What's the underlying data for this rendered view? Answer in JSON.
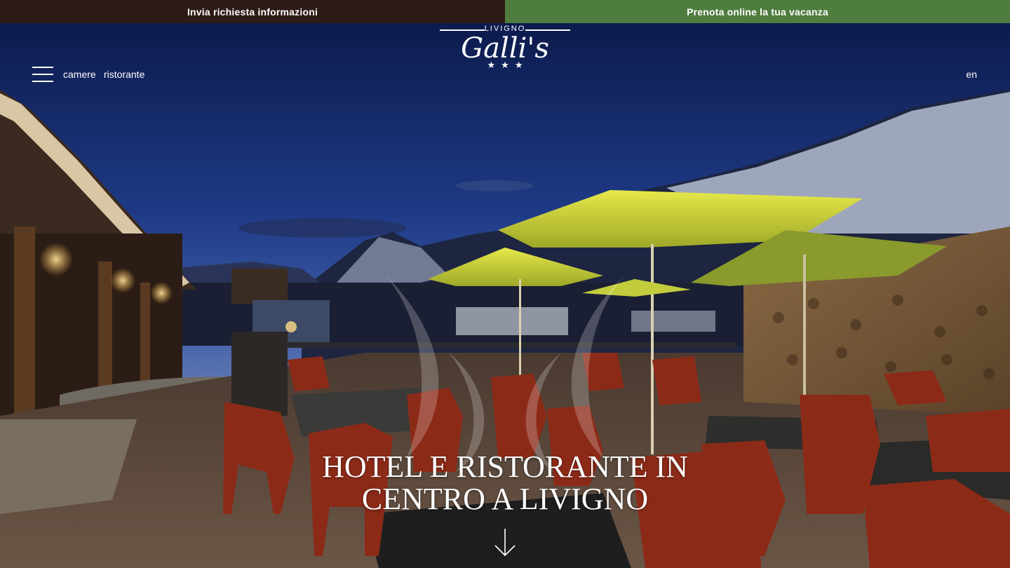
{
  "topbar": {
    "info_label": "Invia richiesta informazioni",
    "book_label": "Prenota online la tua vacanza"
  },
  "nav": {
    "menu_icon": "hamburger-icon",
    "links": [
      "camere",
      "ristorante"
    ],
    "language": "en"
  },
  "logo": {
    "town": "LIVIGNO",
    "name": "Galli's",
    "stars": "★★★"
  },
  "hero": {
    "headline_line1": "HOTEL E RISTORANTE IN",
    "headline_line2": "CENTRO A LIVIGNO",
    "scroll_icon": "arrow-down-icon"
  },
  "colors": {
    "info_bar": "#2e1b17",
    "book_bar": "#4f7d3f"
  }
}
